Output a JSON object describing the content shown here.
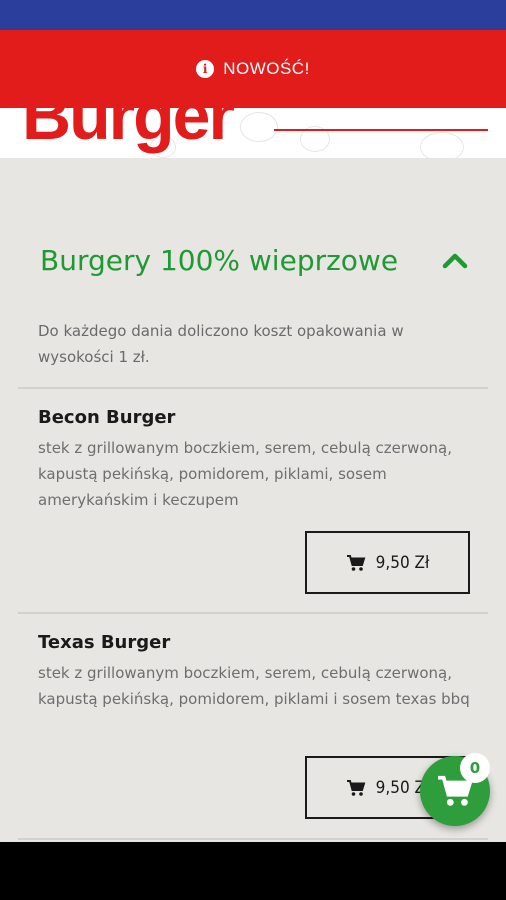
{
  "banner": {
    "label": "NOWOŚĆ!",
    "icon": "info-icon"
  },
  "hero": {
    "title": "Burger"
  },
  "section": {
    "title": "Burgery 100% wieprzowe",
    "toggle_icon": "chevron-up-icon"
  },
  "note": "Do każdego dania doliczono koszt opakowania w wysokości 1 zł.",
  "items": [
    {
      "name": "Becon Burger",
      "description": "stek z grillowanym boczkiem, serem, cebulą czerwoną, kapustą pekińską, pomidorem, piklami, sosem amerykańskim i keczupem",
      "price": "9,50 Zł"
    },
    {
      "name": "Texas Burger",
      "description": "stek z grillowanym boczkiem, serem, cebulą czerwoną, kapustą pekińską, pomidorem, piklami i sosem texas bbq",
      "price": "9,50 Zł"
    }
  ],
  "cart": {
    "count": "0",
    "icon": "cart-icon"
  },
  "colors": {
    "status_bar": "#2c3e9b",
    "brand_red": "#e21b1b",
    "accent_green": "#1f9a33",
    "fab_green": "#2e9d3c",
    "background": "#e8e6e3"
  }
}
